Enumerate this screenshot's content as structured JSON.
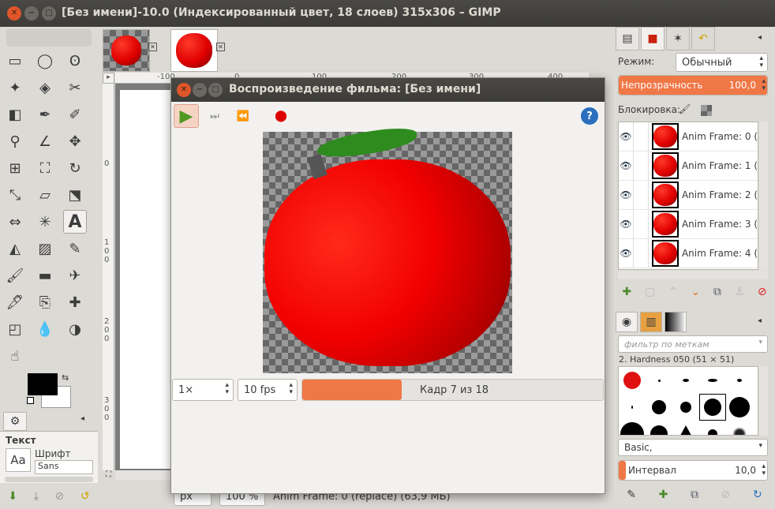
{
  "window": {
    "title": "[Без имени]-10.0 (Индексированный цвет, 18 слоев) 315x306 – GIMP"
  },
  "toolbox": {
    "tools": [
      "rect-select-icon",
      "ellipse-select-icon",
      "free-select-icon",
      "fuzzy-select-icon",
      "color-select-icon",
      "scissors-icon",
      "foreground-select-icon",
      "paths-icon",
      "color-picker-icon",
      "zoom-icon",
      "measure-icon",
      "move-icon",
      "align-icon",
      "crop-icon",
      "rotate-icon",
      "scale-icon",
      "shear-icon",
      "perspective-icon",
      "flip-icon",
      "cage-icon",
      "text-icon",
      "bucket-fill-icon",
      "blend-icon",
      "pencil-icon",
      "paintbrush-icon",
      "eraser-icon",
      "airbrush-icon",
      "ink-icon",
      "clone-icon",
      "heal-icon",
      "perspective-clone-icon",
      "blur-icon",
      "dodge-burn-icon",
      "smudge-icon"
    ],
    "fg_color": "#000000",
    "bg_color": "#ffffff",
    "text_options": {
      "title": "Текст",
      "font_label": "Шрифт",
      "font_value": "Sans",
      "aa": "Aa"
    }
  },
  "image": {
    "ruler_labels": [
      "-100",
      "0",
      "100",
      "200",
      "300",
      "400"
    ],
    "vruler_labels": [
      "0",
      "1 0 0",
      "2 0 0",
      "3 0 0"
    ],
    "status_unit": "px",
    "status_zoom": "100 %",
    "status_text": "Anim Frame: 0 (replace) (63,9 МБ)"
  },
  "dialog": {
    "title": "Воспроизведение фильма: [Без имени]",
    "speed": "1×",
    "fps": "10 fps",
    "frame_label": "Кадр 7 из 18",
    "progress": 0.33,
    "accent": "#f07746"
  },
  "layers": {
    "mode_label": "Режим:",
    "mode_value": "Обычный",
    "opacity_label": "Непрозрачность",
    "opacity_value": "100,0",
    "lock_label": "Блокировка:",
    "items": [
      "Anim Frame: 0 (",
      "Anim Frame: 1 (",
      "Anim Frame: 2 (",
      "Anim Frame: 3 (",
      "Anim Frame: 4 ("
    ]
  },
  "brushes": {
    "filter_placeholder": "фильтр по меткам",
    "current": "2. Hardness 050 (51 × 51)",
    "preset": "Basic,",
    "spacing_label": "Интервал",
    "spacing_value": "10,0",
    "spacing_fraction": 0.05
  }
}
